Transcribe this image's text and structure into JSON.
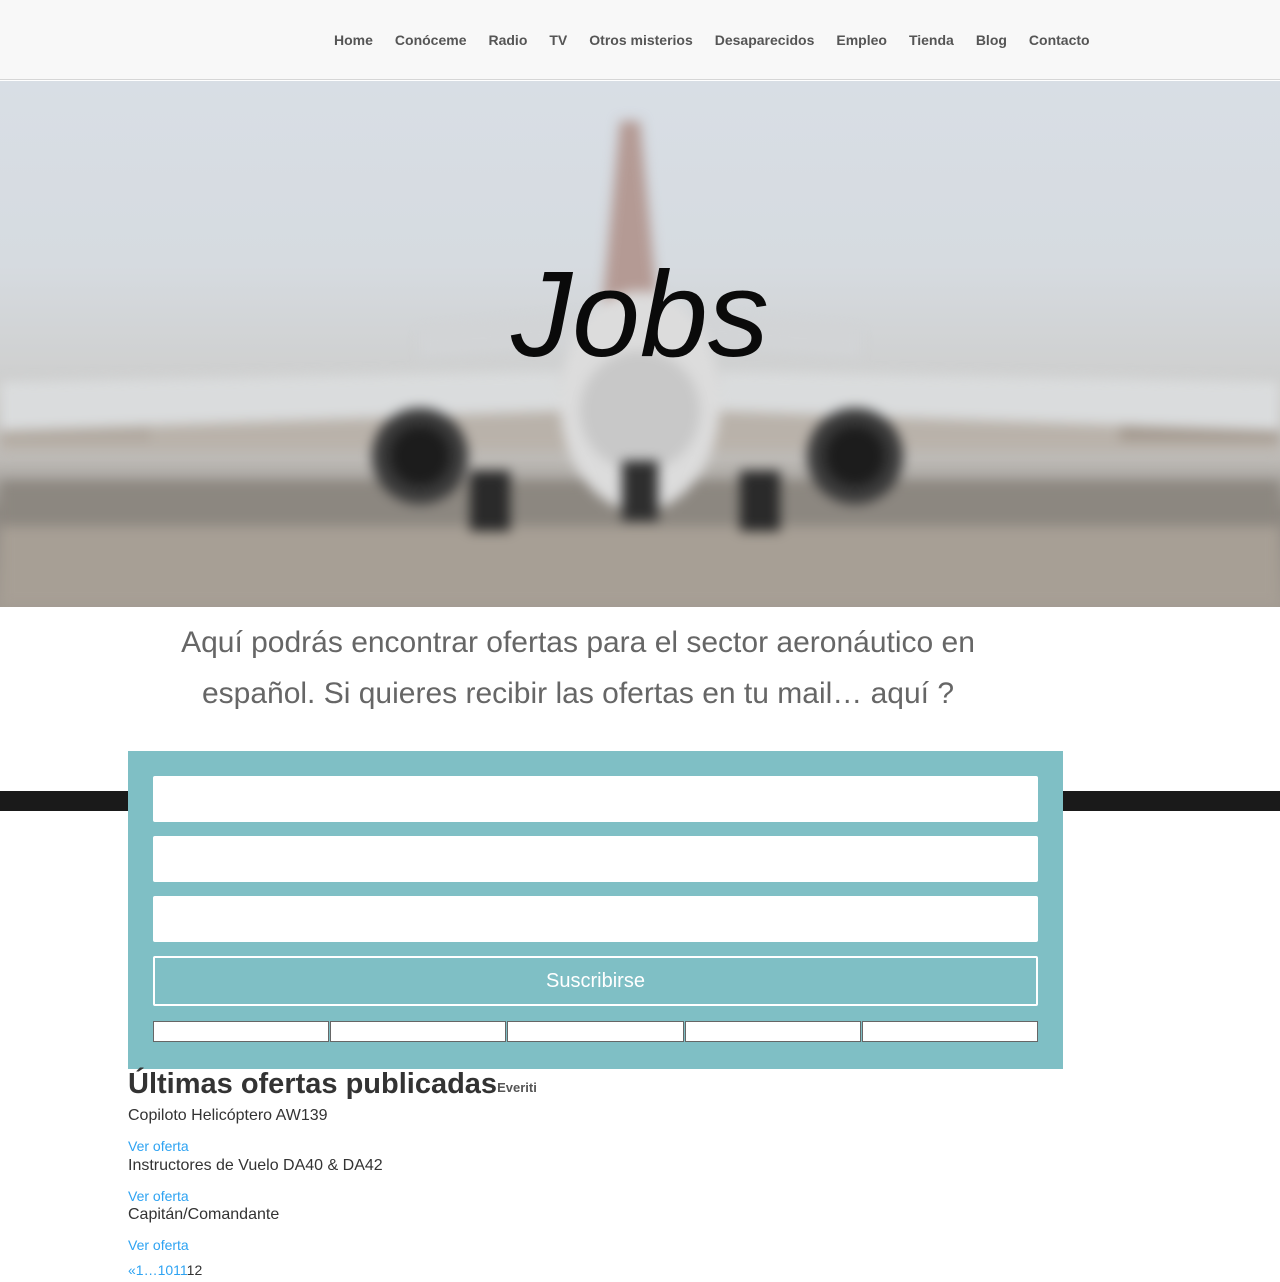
{
  "nav": {
    "items": [
      "Home",
      "Conóceme",
      "Radio",
      "TV",
      "Otros misterios",
      "Desaparecidos",
      "Empleo",
      "Tienda",
      "Blog",
      "Contacto"
    ]
  },
  "hero": {
    "title": "Jobs"
  },
  "intro": {
    "text": "Aquí podrás encontrar ofertas para el sector aeronáutico en español. Si quieres recibir las ofertas en tu mail… aquí ?"
  },
  "form": {
    "submit_label": "Suscribirse",
    "field1_value": "",
    "field2_value": "",
    "field3_value": ""
  },
  "offers": {
    "title": "Últimas ofertas publicadas",
    "badge": "Everiti",
    "items": [
      {
        "title": "Copiloto Helicóptero AW139",
        "link": "Ver oferta"
      },
      {
        "title": "Instructores de Vuelo DA40 & DA42",
        "link": "Ver oferta"
      },
      {
        "title": "Capitán/Comandante",
        "link": "Ver oferta"
      }
    ]
  },
  "pagination": {
    "prev": "«",
    "first": "1",
    "ellipsis": "…",
    "p10": "10",
    "p11": "11",
    "p12": "12"
  }
}
